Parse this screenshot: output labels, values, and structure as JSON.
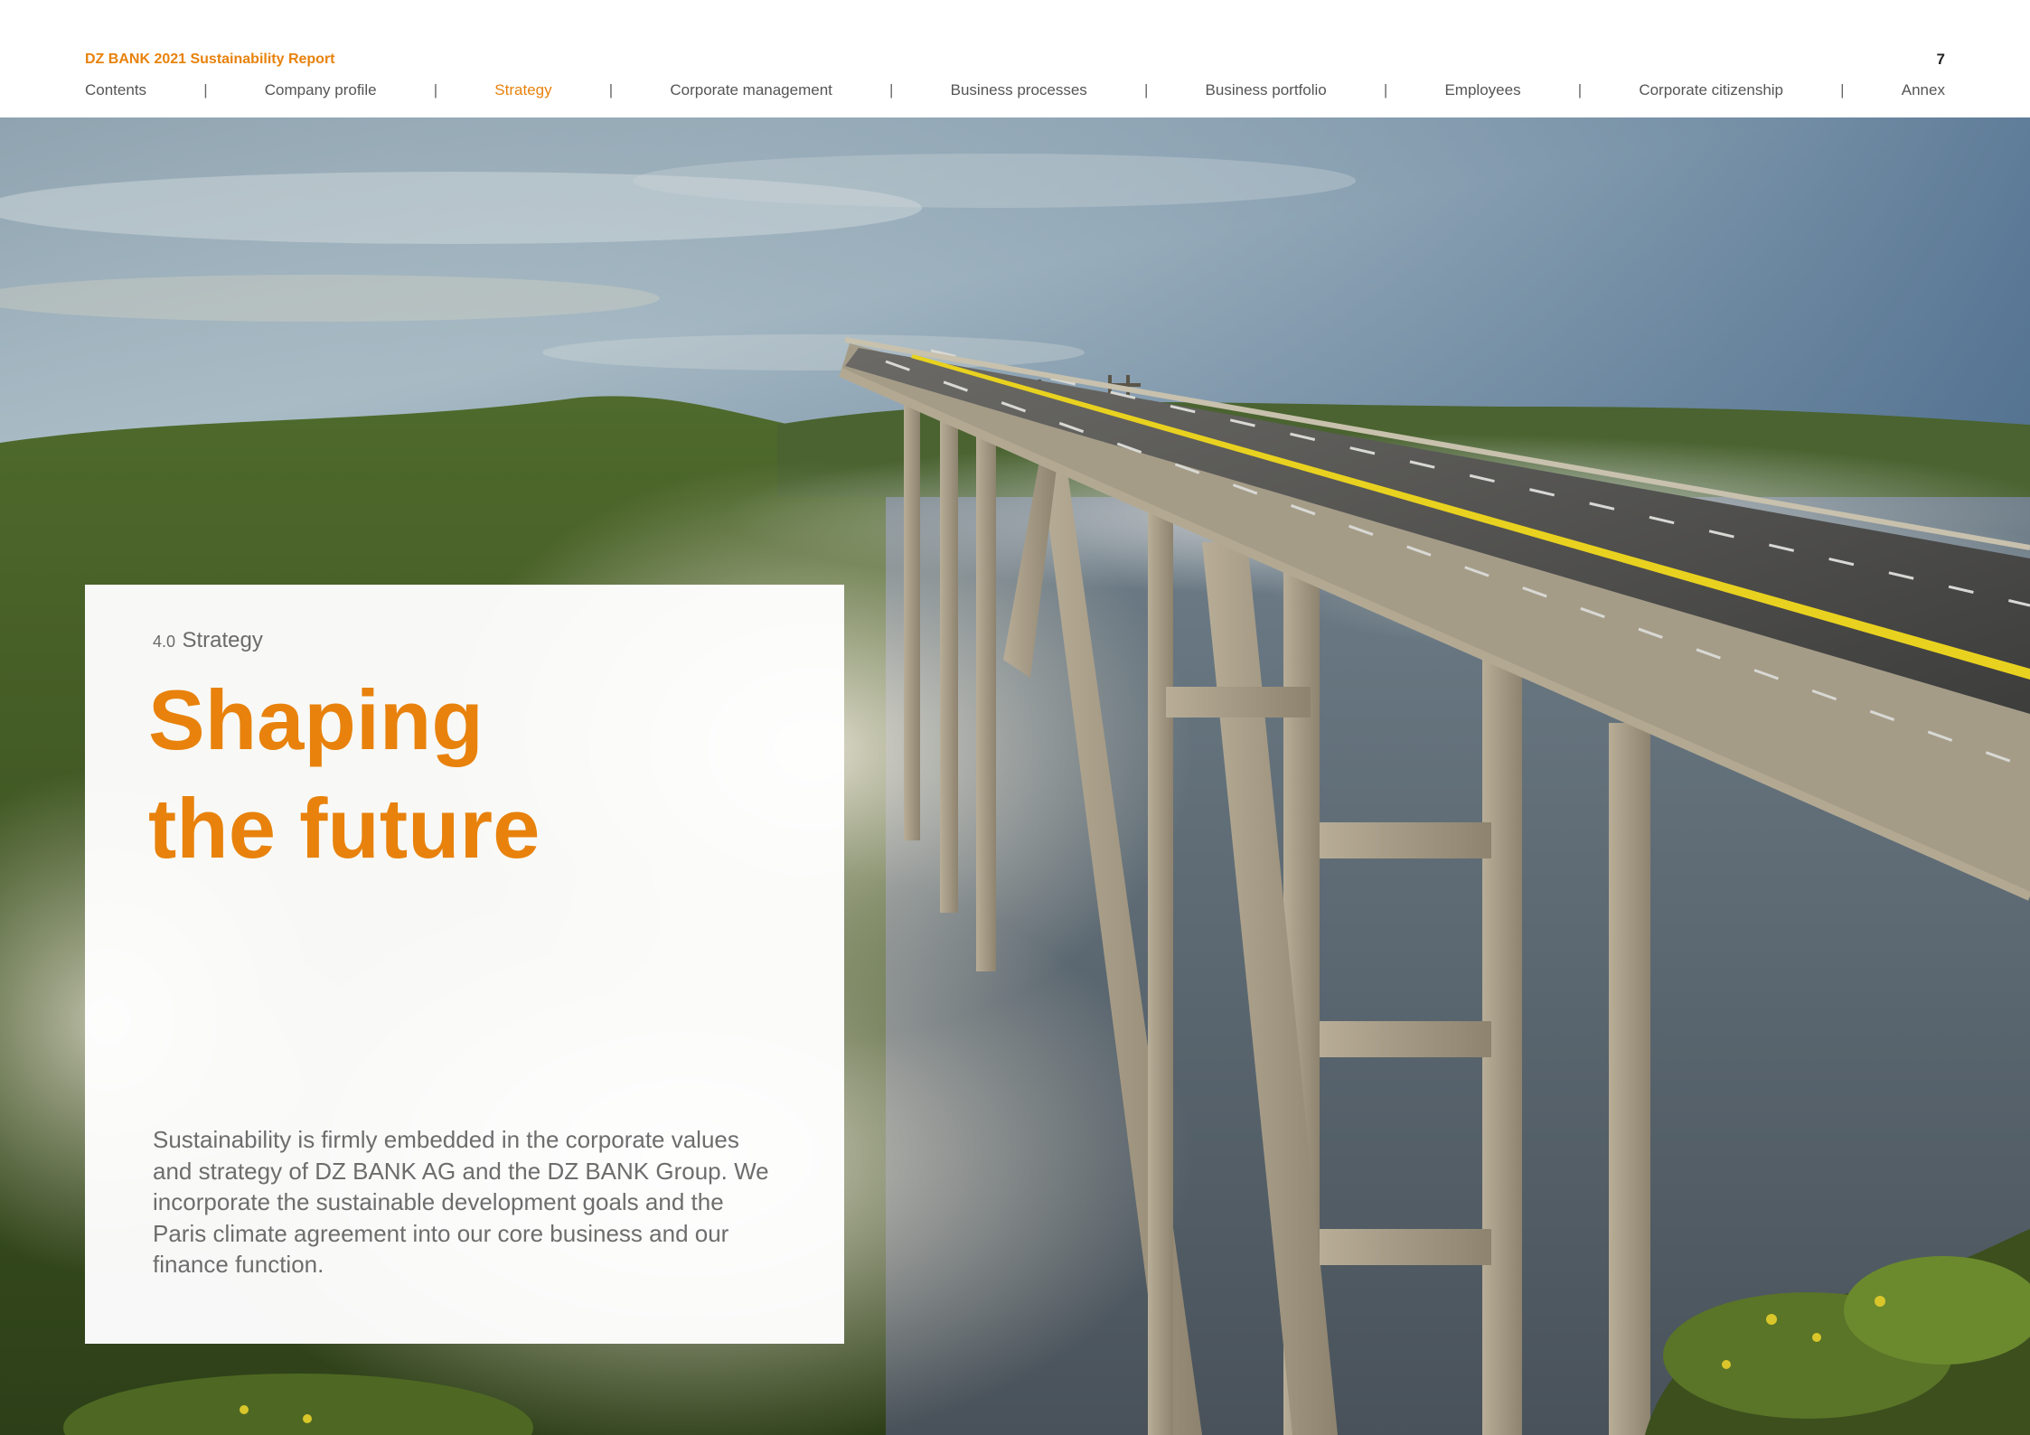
{
  "header": {
    "report_title": "DZ BANK 2021 Sustainability Report",
    "page_number": "7",
    "nav": {
      "items": [
        "Contents",
        "Company profile",
        "Strategy",
        "Corporate management",
        "Business processes",
        "Business portfolio",
        "Employees",
        "Corporate citizenship",
        "Annex"
      ],
      "active": "Strategy",
      "separator": "|"
    }
  },
  "panel": {
    "section_number": "4.0",
    "section_name": "Strategy",
    "headline_line1": "Shaping",
    "headline_line2": "the future",
    "intro_text": "Sustainability is firmly embedded in the corporate values and strategy of DZ BANK AG and the DZ BANK Group. We incorporate the sustainable development goals and the Paris climate agreement into our core business and our finance function."
  },
  "colors": {
    "accent": "#e8820c",
    "nav_text": "#555555",
    "body_text": "#6d6d6d"
  }
}
